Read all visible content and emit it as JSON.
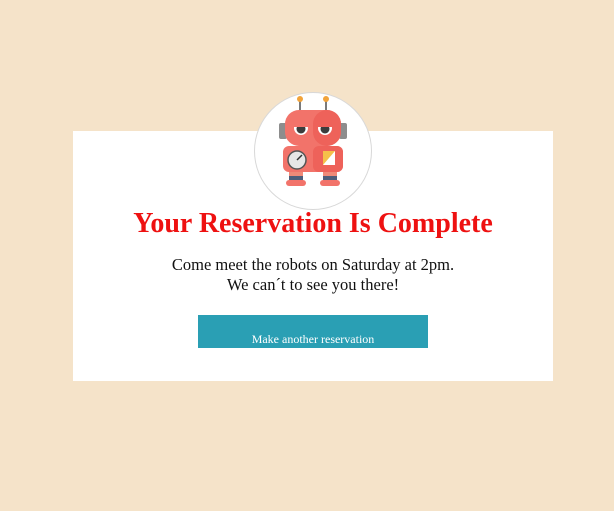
{
  "page": {
    "background": "#f5e3c9",
    "card_color": "#ffffff",
    "accent": "#2a9fb4",
    "title_color": "#ee1111"
  },
  "confirmation": {
    "icon": "robot-icon",
    "title": "Your Reservation Is Complete",
    "message_line1": "Come meet the robots on Saturday at 2pm.",
    "message_line2": "We can´t to see you there!",
    "button_label": "Make another reservation"
  }
}
